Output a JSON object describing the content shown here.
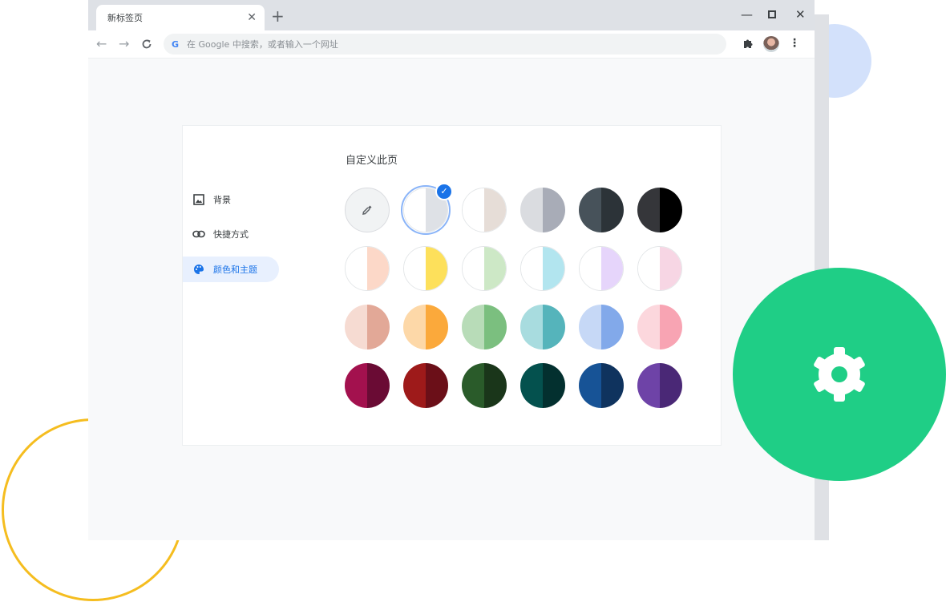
{
  "browser": {
    "tab_title": "新标签页",
    "tab_close": "✕",
    "new_tab": "+",
    "window_controls": {
      "minimize": "—",
      "close": "✕"
    },
    "nav": {
      "back": "←",
      "forward": "→",
      "reload": "C"
    },
    "omnibox": {
      "g_logo": "G",
      "placeholder": "在 Google 中搜索，或者输入一个网址"
    },
    "menu": "⋮"
  },
  "customize": {
    "title": "自定义此页",
    "sidebar": [
      {
        "label": "背景",
        "icon": "image-icon"
      },
      {
        "label": "快捷方式",
        "icon": "link-icon"
      },
      {
        "label": "颜色和主题",
        "icon": "palette-icon",
        "active": true
      }
    ],
    "swatches": [
      [
        {
          "type": "custom",
          "icon": "eyedropper-icon"
        },
        {
          "left": "#ffffff",
          "right": "#dee1e6",
          "selected": true
        },
        {
          "left": "#ffffff",
          "right": "#e6ddd7"
        },
        {
          "left": "#dadce0",
          "right": "#a8acb7"
        },
        {
          "left": "#47525a",
          "right": "#2c3338"
        },
        {
          "left": "#35363a",
          "right": "#000000"
        }
      ],
      [
        {
          "left": "#ffffff",
          "right": "#fcd8c8"
        },
        {
          "left": "#ffffff",
          "right": "#fde05b"
        },
        {
          "left": "#ffffff",
          "right": "#cde8c6"
        },
        {
          "left": "#ffffff",
          "right": "#b2e5ef"
        },
        {
          "left": "#ffffff",
          "right": "#e6d5fb"
        },
        {
          "left": "#ffffff",
          "right": "#f7d6e4"
        }
      ],
      [
        {
          "left": "#f6dbd2",
          "right": "#e2a897"
        },
        {
          "left": "#fdd8a8",
          "right": "#fba93b"
        },
        {
          "left": "#b8dcb8",
          "right": "#7bbf7f"
        },
        {
          "left": "#a8dcdf",
          "right": "#55b4bb"
        },
        {
          "left": "#c6d8f6",
          "right": "#82a9ea"
        },
        {
          "left": "#fcd7dd",
          "right": "#f8a4b3"
        }
      ],
      [
        {
          "left": "#a3114e",
          "right": "#6a0b34"
        },
        {
          "left": "#9e1a1a",
          "right": "#6b0f18"
        },
        {
          "left": "#2a5b2a",
          "right": "#1a361a"
        },
        {
          "left": "#04514e",
          "right": "#03302f"
        },
        {
          "left": "#175396",
          "right": "#0f335e"
        },
        {
          "left": "#6e43a7",
          "right": "#4a2876"
        }
      ]
    ]
  },
  "badge": {
    "icon": "gear-icon",
    "color": "#1fce86"
  }
}
